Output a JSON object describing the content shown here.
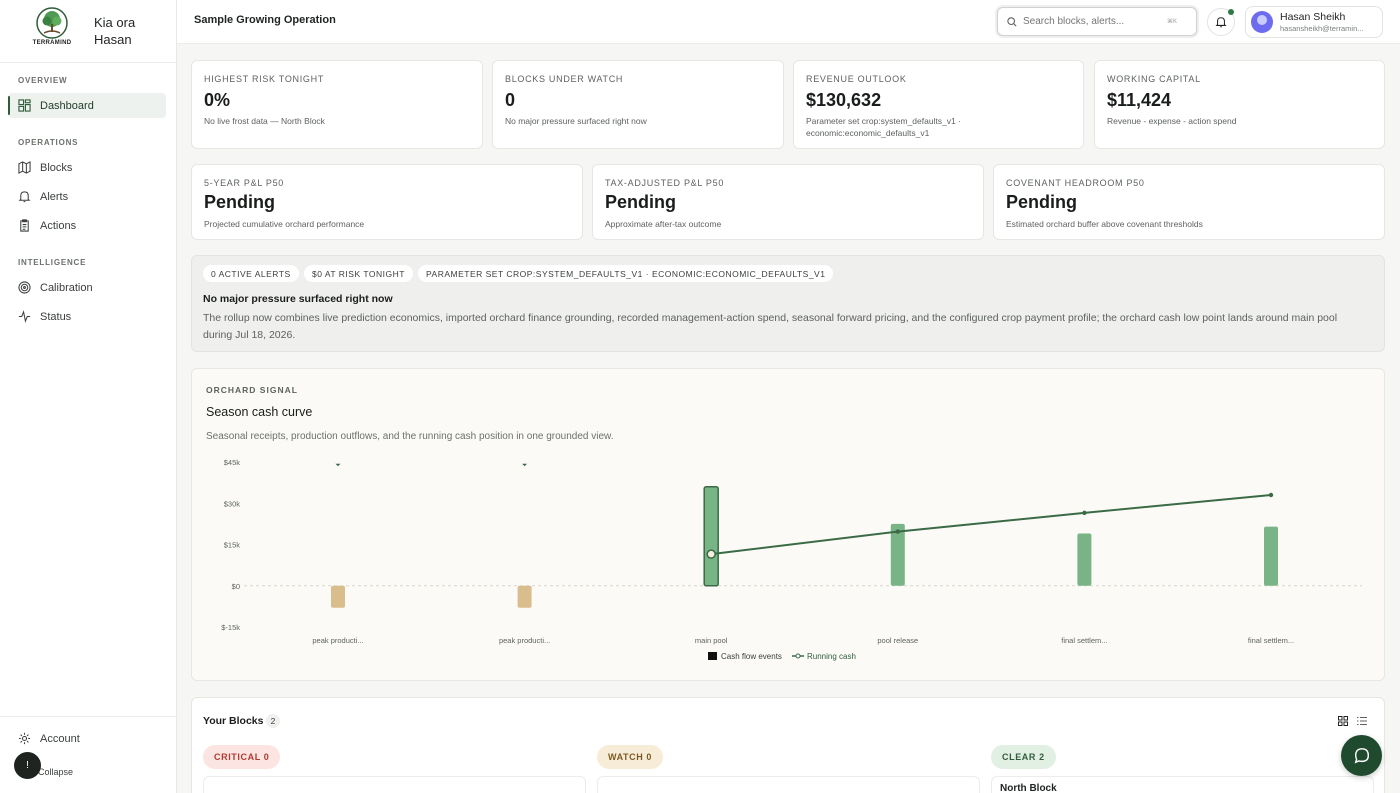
{
  "brand": {
    "logo_text": "TERRAMIND",
    "greeting": "Kia ora Hasan"
  },
  "sidebar": {
    "sections": [
      {
        "label": "Overview",
        "items": [
          {
            "label": "Dashboard",
            "icon": "grid-icon",
            "active": true
          }
        ]
      },
      {
        "label": "Operations",
        "items": [
          {
            "label": "Blocks",
            "icon": "map-icon"
          },
          {
            "label": "Alerts",
            "icon": "bell-icon"
          },
          {
            "label": "Actions",
            "icon": "clipboard-icon"
          }
        ]
      },
      {
        "label": "Intelligence",
        "items": [
          {
            "label": "Calibration",
            "icon": "target-icon"
          },
          {
            "label": "Status",
            "icon": "activity-icon"
          }
        ]
      }
    ],
    "account_label": "Account",
    "collapse_label": "Collapse",
    "collapse_glyph": "!"
  },
  "topbar": {
    "title": "Sample Growing Operation",
    "search_placeholder": "Search blocks, alerts...",
    "search_shortcut": "⌘K",
    "user_name": "Hasan Sheikh",
    "user_email": "hasansheikh@terramin..."
  },
  "kpis_row1": [
    {
      "label": "Highest risk tonight",
      "value": "0%",
      "sub": "No live frost data — North Block"
    },
    {
      "label": "Blocks under watch",
      "value": "0",
      "sub": "No major pressure surfaced right now"
    },
    {
      "label": "Revenue outlook",
      "value": "$130,632",
      "sub": "Parameter set crop:system_defaults_v1 · economic:economic_defaults_v1"
    },
    {
      "label": "Working capital",
      "value": "$11,424",
      "sub": "Revenue - expense - action spend"
    }
  ],
  "kpis_row2": [
    {
      "label": "5-year P&L P50",
      "value": "Pending",
      "sub": "Projected cumulative orchard performance"
    },
    {
      "label": "Tax-adjusted P&L P50",
      "value": "Pending",
      "sub": "Approximate after-tax outcome"
    },
    {
      "label": "Covenant headroom P50",
      "value": "Pending",
      "sub": "Estimated orchard buffer above covenant thresholds"
    }
  ],
  "summary": {
    "chips": [
      "0 active alerts",
      "$0 at risk tonight",
      "Parameter set crop:system_defaults_v1 · economic:economic_defaults_v1"
    ],
    "title": "No major pressure surfaced right now",
    "body": "The rollup now combines live prediction economics, imported orchard finance grounding, recorded management-action spend, seasonal forward pricing, and the configured crop payment profile; the orchard cash low point lands around main pool during Jul 18, 2026."
  },
  "chart_section": {
    "eyebrow": "ORCHARD SIGNAL",
    "title": "Season cash curve",
    "subtitle": "Seasonal receipts, production outflows, and the running cash position in one grounded view."
  },
  "chart_data": {
    "type": "bar",
    "categories": [
      "peak producti...",
      "peak producti...",
      "main pool",
      "pool release",
      "final settlem...",
      "final settlem..."
    ],
    "y_ticks": [
      "$45k",
      "$30k",
      "$15k",
      "$0",
      "$-15k"
    ],
    "ylim": [
      -15000,
      45000
    ],
    "series": [
      {
        "name": "Cash flow events",
        "kind": "bar",
        "values": [
          -8000,
          -8000,
          36000,
          22500,
          19000,
          21500
        ],
        "colors": [
          "#d9bd8c",
          "#d9bd8c",
          "#79b486",
          "#79b486",
          "#79b486",
          "#79b486"
        ]
      },
      {
        "name": "Running cash",
        "kind": "line",
        "values": [
          44000,
          44000,
          11500,
          19700,
          26500,
          33000
        ],
        "color": "#3b6a46"
      }
    ],
    "legend": "bottom",
    "grid": false
  },
  "blocks": {
    "title": "Your Blocks",
    "count": "2",
    "columns": [
      {
        "label": "CRITICAL 0",
        "bg": "#fbe4e2",
        "fg": "#b23a30"
      },
      {
        "label": "WATCH 0",
        "bg": "#f7ecd8",
        "fg": "#7a5a20"
      },
      {
        "label": "CLEAR 2",
        "bg": "#e2efe3",
        "fg": "#2f5d3a"
      }
    ],
    "first_clear_block": "North Block"
  },
  "colors": {
    "accent": "#2f5d3a",
    "fab": "#1f4a2d"
  }
}
